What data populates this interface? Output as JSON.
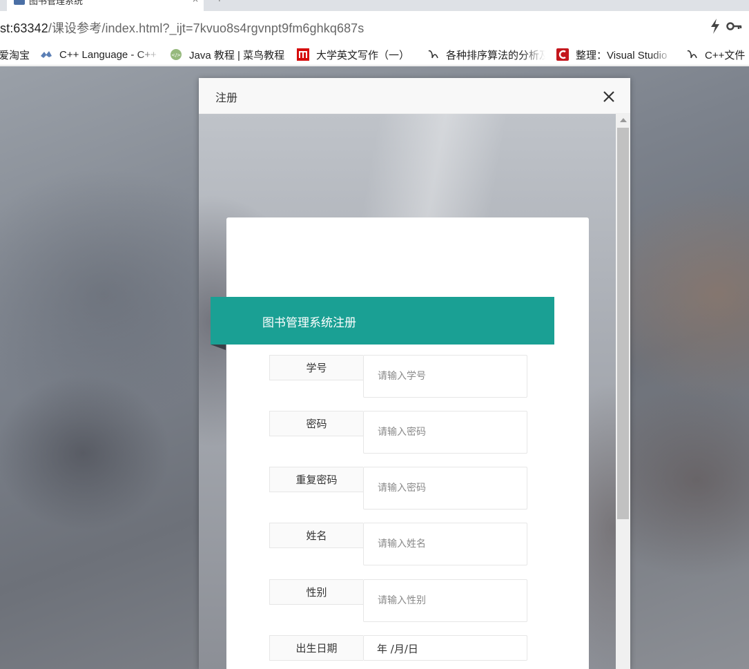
{
  "browser": {
    "tab": {
      "title": "图书管理系统",
      "close": "×"
    },
    "new_tab": "+",
    "url": {
      "host": "st:63342",
      "path": "/课设参考/index.html?_ijt=7kvuo8s4rgvnpt9fm6ghkq687s"
    },
    "bookmarks": [
      {
        "label": "爱淘宝",
        "icon": "taobao-icon"
      },
      {
        "label": "C++ Language - C++",
        "icon": "cplusplus-icon"
      },
      {
        "label": "Java 教程 | 菜鸟教程",
        "icon": "runoob-icon"
      },
      {
        "label": "大学英文写作（一）",
        "icon": "mooc-icon"
      },
      {
        "label": "各种排序算法的分析及",
        "icon": "csdn-icon"
      },
      {
        "label": "整理：Visual Studio",
        "icon": "cnblogs-icon"
      },
      {
        "label": "C++文件",
        "icon": "csdn-icon"
      }
    ]
  },
  "modal": {
    "title": "注册",
    "close_icon": "close-icon",
    "banner_title": "图书管理系统注册",
    "fields": [
      {
        "label": "学号",
        "placeholder": "请输入学号"
      },
      {
        "label": "密码",
        "placeholder": "请输入密码"
      },
      {
        "label": "重复密码",
        "placeholder": "请输入密码"
      },
      {
        "label": "姓名",
        "placeholder": "请输入姓名"
      },
      {
        "label": "性别",
        "placeholder": "请输入性别"
      }
    ],
    "birth_date": {
      "label": "出生日期",
      "value": "年 /月/日"
    }
  },
  "colors": {
    "banner": "#1aa094",
    "modal_header": "#f8f8f8"
  }
}
